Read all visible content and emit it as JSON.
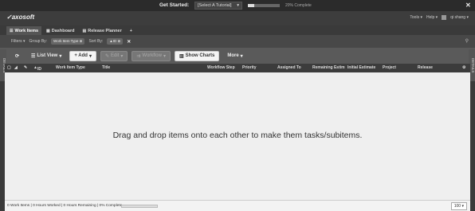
{
  "topbar": {
    "get_started": "Get Started:",
    "tutorial_select": "[Select A Tutorial]",
    "progress_percent": 20,
    "progress_text": "20% Complete"
  },
  "brand": {
    "logo": "axosoft",
    "tools": "Tools",
    "help": "Help",
    "user": "qi shang"
  },
  "tabs": [
    {
      "label": "Work Items",
      "icon": "list-icon"
    },
    {
      "label": "Dashboard",
      "icon": "dashboard-icon"
    },
    {
      "label": "Release Planner",
      "icon": "calendar-icon"
    },
    {
      "label": "+",
      "icon": "add-tab-icon"
    }
  ],
  "filters": {
    "label": "Filters",
    "group_by": "Group By:",
    "group_value": "Work Item Type",
    "sort_by": "Sort By:",
    "sort_value": "ID"
  },
  "toolbar": {
    "list_view": "List View",
    "add": "+ Add",
    "edit": "Edit",
    "workflow": "Workflow",
    "show_charts": "Show Charts",
    "more": "More"
  },
  "side_tabs": {
    "left": "DETAILS",
    "right": "DETAILS"
  },
  "columns": [
    "ID",
    "Work Item Type",
    "Title",
    "Workflow Step",
    "Priority",
    "Assigned To",
    "Remaining Estim",
    "Initial Estimate",
    "Project",
    "Release"
  ],
  "grid": {
    "empty_message": "Drag and drop items onto each other to make them tasks/subitems."
  },
  "status": {
    "summary": "0 Work Items | 0 Hours Worked | 0 Hours Remaining | 0% Complete",
    "page_size": "100"
  }
}
